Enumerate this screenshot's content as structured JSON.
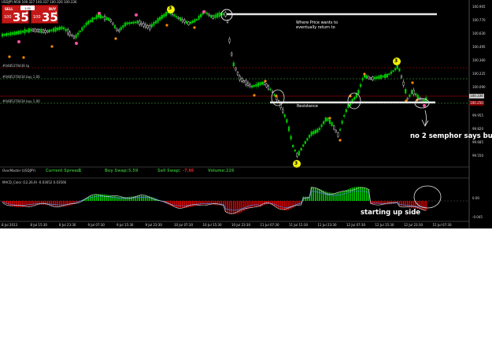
{
  "header": {
    "symbol_line": "USDJPY,M30  100.327 100.337 100.326 100.336"
  },
  "trade_panel": {
    "sell_label": "SELL",
    "buy_label": "BUY",
    "lot_value": "1.00",
    "sell_price_prefix": "100",
    "sell_price_big": "35",
    "sell_price_sup": "0",
    "buy_price_prefix": "100",
    "buy_price_big": "35",
    "buy_price_sup": "1"
  },
  "level_labels": {
    "upper": "#0485370436 tp",
    "middle": "#0485370434 buy 1.00",
    "lower": "#0485370434 buy 1.00"
  },
  "annotations": {
    "return_note_1": "Where Price wants to",
    "return_note_2": "eventually return to",
    "resistance_label": "Resistance",
    "buy_note": "no 2 semphor says buy",
    "oscillator_note": "starting up side"
  },
  "semaphore_numbers": {
    "top_left": "3",
    "top_right": "3",
    "bottom": "3"
  },
  "price_axis": {
    "ticks": [
      "100.905",
      "100.770",
      "100.630",
      "100.495",
      "100.360",
      "100.225",
      "100.090",
      "99.955",
      "99.820",
      "99.685",
      "99.550"
    ],
    "current_price": "100.336",
    "sl_price": "100.250"
  },
  "status_bar": {
    "name": "OverMaster (USDJPY)",
    "current_spread_label": "Current Spread:",
    "current_spread_value": "1",
    "buy_swap_label": "Buy Swap:",
    "buy_swap_value": "5.59",
    "sell_swap_label": "Sell Swap:",
    "sell_swap_value": "-7.86",
    "volume_label": "Volume:",
    "volume_value": "226"
  },
  "oscillator": {
    "title": "MACD_Color (12,26,9)  -0.03652  0.03566",
    "axis_ticks": [
      "0.00",
      "-0.045"
    ]
  },
  "time_axis": {
    "ticks": [
      "8 Jul 2013",
      "8 Jul 15:30",
      "8 Jul 23:30",
      "9 Jul 07:30",
      "9 Jul 15:30",
      "9 Jul 23:30",
      "10 Jul 07:30",
      "10 Jul 15:30",
      "10 Jul 23:30",
      "11 Jul 07:30",
      "11 Jul 15:30",
      "11 Jul 23:30",
      "12 Jul 07:30",
      "12 Jul 15:30",
      "12 Jul 23:30",
      "15 Jul 07:30"
    ]
  },
  "colors": {
    "background": "#000000",
    "bull_candle": "#00cc00",
    "bear_candle": "#ffffff",
    "semaphore_yellow": "#f4f400",
    "semaphore_pink": "#ff4fa0",
    "semaphore_orange": "#ff8c00",
    "level_red": "#8b0000",
    "level_green": "#2f7d2f",
    "macd_up": "#00cc00",
    "macd_down": "#e00000",
    "resistance": "#e8e8e8"
  }
}
